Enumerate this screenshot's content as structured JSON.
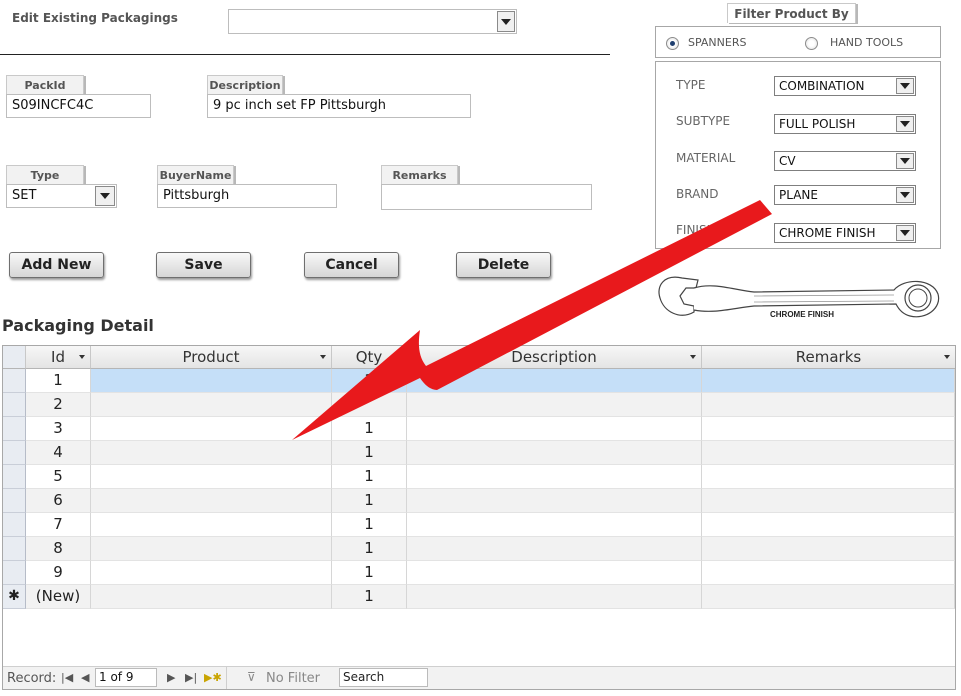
{
  "header": {
    "edit_label": "Edit Existing Packagings",
    "edit_value": ""
  },
  "form": {
    "packid": {
      "label": "PackId",
      "value": "S09INCFC4C"
    },
    "description": {
      "label": "Description",
      "value": "9 pc inch set FP Pittsburgh"
    },
    "type": {
      "label": "Type",
      "value": "SET"
    },
    "buyername": {
      "label": "BuyerName",
      "value": "Pittsburgh"
    },
    "remarks": {
      "label": "Remarks",
      "value": ""
    }
  },
  "buttons": {
    "add_new": "Add New",
    "save": "Save",
    "cancel": "Cancel",
    "delete": "Delete"
  },
  "filter": {
    "title": "Filter Product By",
    "radio_spanners": "SPANNERS",
    "radio_hand_tools": "HAND TOOLS",
    "selected": "SPANNERS",
    "type_label": "TYPE",
    "type_value": "COMBINATION",
    "subtype_label": "SUBTYPE",
    "subtype_value": "FULL POLISH",
    "material_label": "MATERIAL",
    "material_value": "CV",
    "brand_label": "BRAND",
    "brand_value": "PLANE",
    "finish_label": "FINISH",
    "finish_value": "CHROME FINISH"
  },
  "wrench_caption": "CHROME FINISH",
  "detail": {
    "title": "Packaging Detail",
    "columns": [
      "Id",
      "Product",
      "Qty",
      "Description",
      "Remarks"
    ],
    "rows": [
      {
        "id": "1",
        "product": "",
        "qty": "1",
        "description": "",
        "remarks": ""
      },
      {
        "id": "2",
        "product": "",
        "qty": "",
        "description": "",
        "remarks": ""
      },
      {
        "id": "3",
        "product": "",
        "qty": "1",
        "description": "",
        "remarks": ""
      },
      {
        "id": "4",
        "product": "",
        "qty": "1",
        "description": "",
        "remarks": ""
      },
      {
        "id": "5",
        "product": "",
        "qty": "1",
        "description": "",
        "remarks": ""
      },
      {
        "id": "6",
        "product": "",
        "qty": "1",
        "description": "",
        "remarks": ""
      },
      {
        "id": "7",
        "product": "",
        "qty": "1",
        "description": "",
        "remarks": ""
      },
      {
        "id": "8",
        "product": "",
        "qty": "1",
        "description": "",
        "remarks": ""
      },
      {
        "id": "9",
        "product": "",
        "qty": "1",
        "description": "",
        "remarks": ""
      },
      {
        "id": "(New)",
        "product": "",
        "qty": "1",
        "description": "",
        "remarks": ""
      }
    ],
    "new_row_marker": "✱"
  },
  "navbar": {
    "record_label": "Record:",
    "record_value": "1 of 9",
    "no_filter": "No Filter",
    "search": "Search"
  },
  "colors": {
    "selected_row": "#c5dff8",
    "arrow": "#e8191c"
  }
}
